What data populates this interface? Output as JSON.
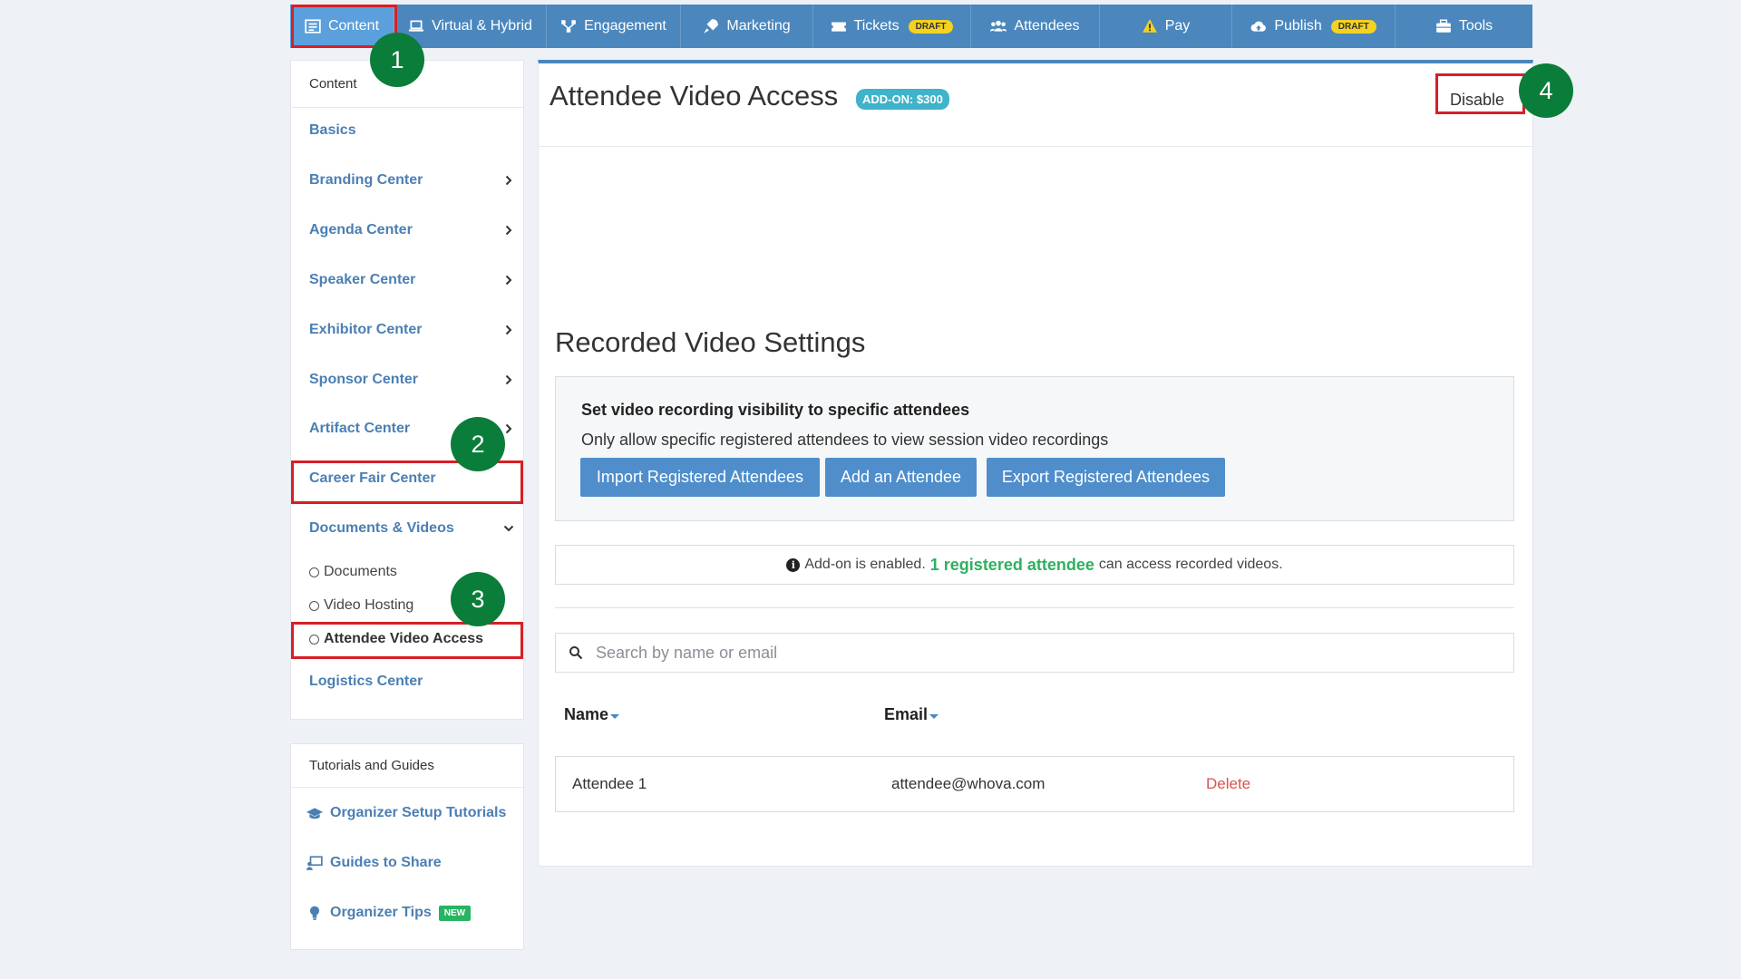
{
  "topnav": {
    "items": [
      {
        "label": "Content",
        "icon": "list-icon"
      },
      {
        "label": "Virtual & Hybrid",
        "icon": "laptop-icon"
      },
      {
        "label": "Engagement",
        "icon": "network-icon"
      },
      {
        "label": "Marketing",
        "icon": "rocket-icon"
      },
      {
        "label": "Tickets",
        "icon": "ticket-icon",
        "badge": "DRAFT"
      },
      {
        "label": "Attendees",
        "icon": "users-icon"
      },
      {
        "label": "Pay",
        "icon": "warning-icon"
      },
      {
        "label": "Publish",
        "icon": "cloud-upload-icon",
        "badge": "DRAFT"
      },
      {
        "label": "Tools",
        "icon": "toolbox-icon"
      }
    ]
  },
  "sidebar": {
    "header": "Content",
    "items": [
      {
        "label": "Basics"
      },
      {
        "label": "Branding Center"
      },
      {
        "label": "Agenda Center"
      },
      {
        "label": "Speaker Center"
      },
      {
        "label": "Exhibitor Center"
      },
      {
        "label": "Sponsor Center"
      },
      {
        "label": "Artifact Center"
      },
      {
        "label": "Career Fair Center"
      },
      {
        "label": "Documents & Videos"
      }
    ],
    "sub_items": [
      {
        "label": "Documents"
      },
      {
        "label": "Video Hosting"
      },
      {
        "label": "Attendee Video Access"
      }
    ],
    "last_item": "Logistics Center"
  },
  "tutorials": {
    "header": "Tutorials and Guides",
    "items": [
      {
        "label": "Organizer Setup Tutorials",
        "icon": "graduation-cap-icon"
      },
      {
        "label": "Guides to Share",
        "icon": "presentation-icon"
      },
      {
        "label": "Organizer Tips",
        "icon": "lightbulb-icon",
        "badge": "NEW"
      }
    ]
  },
  "main": {
    "title": "Attendee Video Access",
    "addon_badge": "ADD-ON: $300",
    "disable_label": "Disable",
    "section_title": "Recorded Video Settings",
    "settings": {
      "heading": "Set video recording visibility to specific attendees",
      "description": "Only allow specific registered attendees to view session video recordings",
      "import_label": "Import Registered Attendees",
      "add_label": "Add an Attendee",
      "export_label": "Export Registered Attendees"
    },
    "info": {
      "prefix": "Add-on is enabled.",
      "highlight": "1 registered attendee",
      "suffix": "can access recorded videos."
    },
    "search_placeholder": "Search by name or email",
    "table": {
      "columns": [
        "Name",
        "Email"
      ],
      "rows": [
        {
          "name": "Attendee 1",
          "email": "attendee@whova.com",
          "action": "Delete"
        }
      ]
    }
  },
  "annotations": {
    "markers": [
      "1",
      "2",
      "3",
      "4"
    ]
  },
  "colors": {
    "nav_bg": "#4b87bd",
    "nav_active": "#5b9fdc",
    "link_blue": "#4b7fb3",
    "annotation_red": "#d71f26",
    "marker_green": "#0a7d3a",
    "success_green": "#2fb05f",
    "draft_yellow": "#f4d21f"
  }
}
